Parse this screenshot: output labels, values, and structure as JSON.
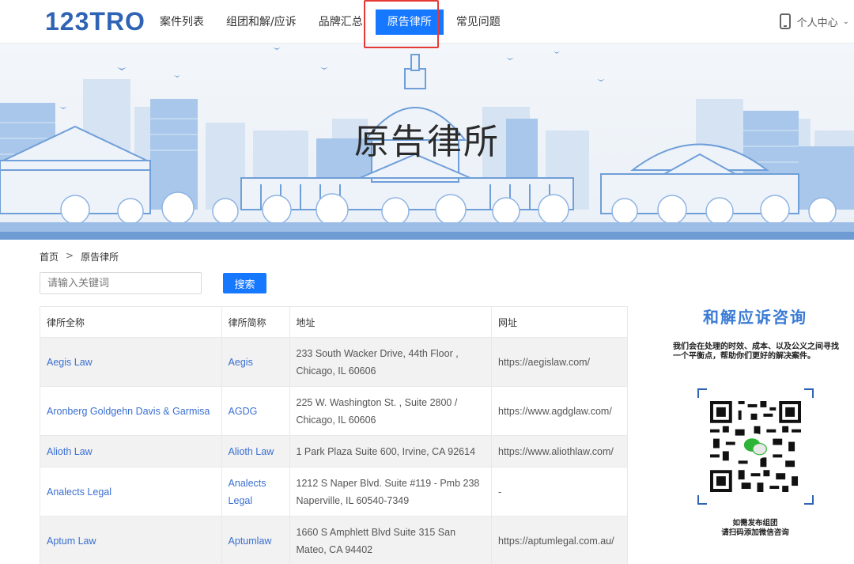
{
  "header": {
    "logo": "123TRO",
    "nav": [
      {
        "label": "案件列表"
      },
      {
        "label": "组团和解/应诉"
      },
      {
        "label": "品牌汇总"
      },
      {
        "label": "原告律所",
        "active": true
      },
      {
        "label": "常见问题"
      }
    ],
    "user_center": "个人中心"
  },
  "banner": {
    "title": "原告律所"
  },
  "breadcrumb": {
    "home": "首页",
    "separator": ">",
    "current": "原告律所"
  },
  "search": {
    "placeholder": "请输入关键词",
    "button": "搜索"
  },
  "table": {
    "columns": [
      "律所全称",
      "律所简称",
      "地址",
      "网址"
    ],
    "rows": [
      {
        "full": "Aegis Law",
        "short": "Aegis",
        "address": "233 South Wacker Drive, 44th Floor , Chicago, IL 60606",
        "url": "https://aegislaw.com/"
      },
      {
        "full": "Aronberg Goldgehn Davis & Garmisa",
        "short": "AGDG",
        "address": "225 W. Washington St. , Suite 2800 / Chicago, IL 60606",
        "url": "https://www.agdglaw.com/"
      },
      {
        "full": "Alioth Law",
        "short": "Alioth Law",
        "address": "1 Park Plaza Suite 600, Irvine, CA 92614",
        "url": "https://www.aliothlaw.com/"
      },
      {
        "full": "Analects Legal",
        "short": "Analects Legal",
        "address": "1212 S Naper Blvd. Suite #119 - Pmb 238 Naperville, IL 60540-7349",
        "url": "-"
      },
      {
        "full": "Aptum Law",
        "short": "Aptumlaw",
        "address": "1660 S Amphlett Blvd Suite 315 San Mateo, CA 94402",
        "url": "https://aptumlegal.com.au/"
      }
    ]
  },
  "sidebar": {
    "title": "和解应诉咨询",
    "description": "我们会在处理的时效、成本、以及公义之间寻找一个平衡点，帮助你们更好的解决案件。",
    "qr_icon": "wechat-qr-icon",
    "footer_line1": "如需发布组团",
    "footer_line2": "请扫码添加微信咨询"
  },
  "colors": {
    "accent": "#1677ff",
    "link": "#3a6fd0",
    "highlight_border": "#e53935",
    "brand": "#2f64b5"
  }
}
